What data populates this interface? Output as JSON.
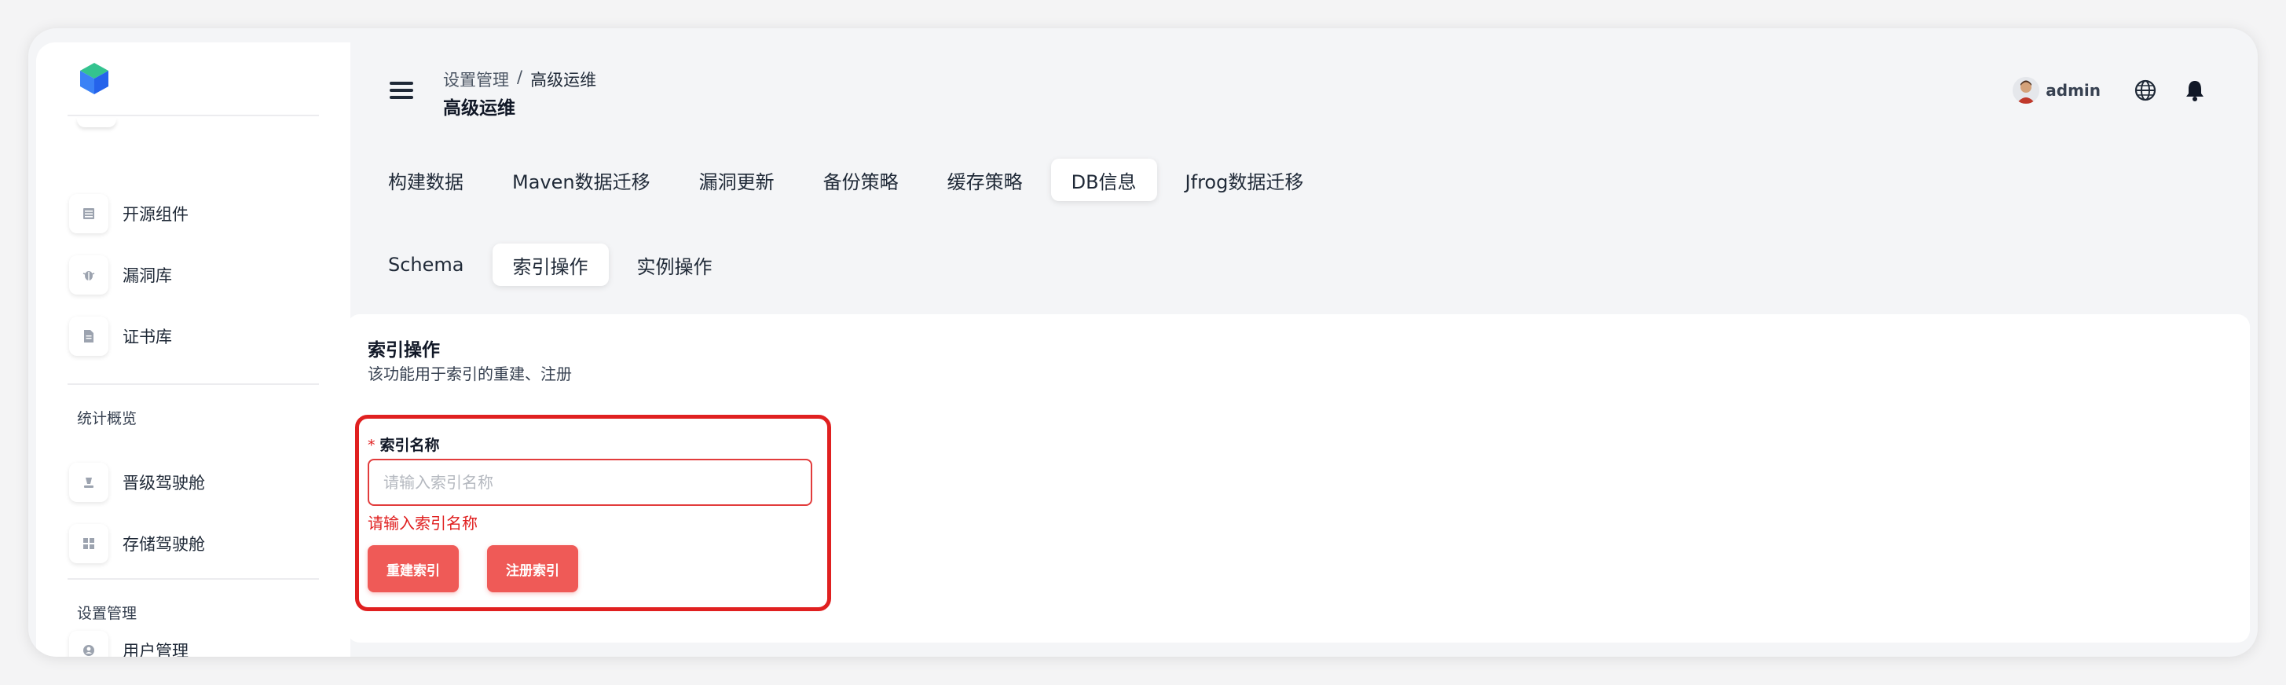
{
  "header": {
    "breadcrumb": [
      "设置管理",
      "高级运维"
    ],
    "breadcrumb_sep": "/",
    "title": "高级运维",
    "user": "admin"
  },
  "sidebar": {
    "items": [
      {
        "label": "开源组件",
        "icon": "table-icon"
      },
      {
        "label": "漏洞库",
        "icon": "bug-icon"
      },
      {
        "label": "证书库",
        "icon": "document-icon"
      }
    ],
    "section_stats": "统计概览",
    "stats_items": [
      {
        "label": "晋级驾驶舱",
        "icon": "cockpit-icon"
      },
      {
        "label": "存储驾驶舱",
        "icon": "grid-icon"
      }
    ],
    "section_settings": "设置管理",
    "settings_items": [
      {
        "label": "用户管理",
        "icon": "user-icon"
      }
    ]
  },
  "tabs": [
    "构建数据",
    "Maven数据迁移",
    "漏洞更新",
    "备份策略",
    "缓存策略",
    "DB信息",
    "Jfrog数据迁移"
  ],
  "active_tab": "DB信息",
  "subtabs": [
    "Schema",
    "索引操作",
    "实例操作"
  ],
  "active_subtab": "索引操作",
  "card": {
    "title": "索引操作",
    "description": "该功能用于索引的重建、注册",
    "field_required_mark": "*",
    "field_label": "索引名称",
    "field_placeholder": "请输入索引名称",
    "field_value": "",
    "field_error": "请输入索引名称",
    "rebuild_button": "重建索引",
    "register_button": "注册索引"
  },
  "colors": {
    "accent": "#ef5a57",
    "error": "#e02020",
    "highlight_border": "#e02020"
  }
}
